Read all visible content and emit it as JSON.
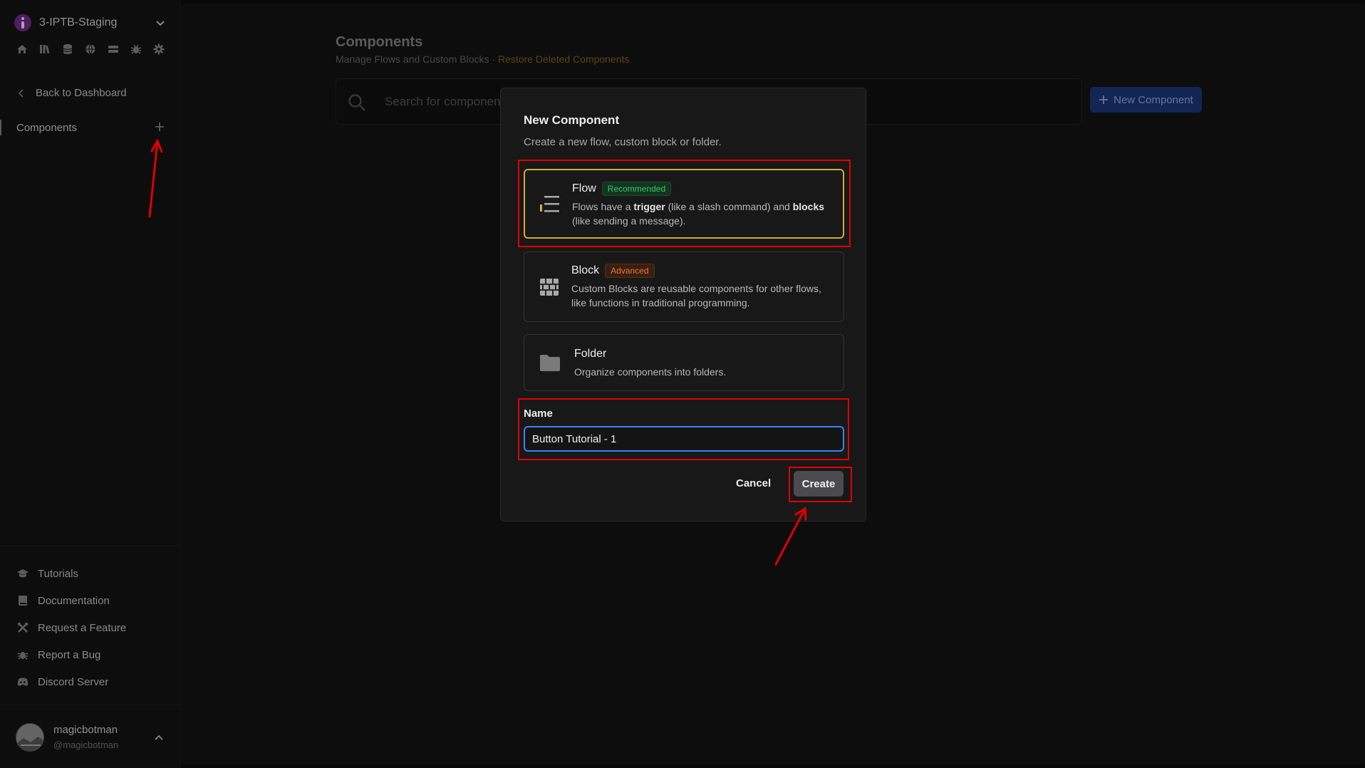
{
  "workspace": {
    "name": "3-IPTB-Staging"
  },
  "sidebar": {
    "icons": [
      "home-icon",
      "library-icon",
      "database-icon",
      "globe-icon",
      "server-icon",
      "bug-icon",
      "gear-icon"
    ],
    "back_label": "Back to Dashboard",
    "section_label": "Components",
    "bottom_links": [
      {
        "label": "Tutorials",
        "icon": "graduation-cap-icon"
      },
      {
        "label": "Documentation",
        "icon": "book-icon"
      },
      {
        "label": "Request a Feature",
        "icon": "tools-icon"
      },
      {
        "label": "Report a Bug",
        "icon": "bug-icon"
      },
      {
        "label": "Discord Server",
        "icon": "discord-icon"
      }
    ],
    "user": {
      "name": "magicbotman",
      "handle": "@magicbotman"
    }
  },
  "main": {
    "title": "Components",
    "subtitle": "Manage Flows and Custom Blocks",
    "separator": " · ",
    "restore_link": "Restore Deleted Components",
    "search_placeholder": "Search for components",
    "new_button": "New Component"
  },
  "modal": {
    "title": "New Component",
    "description": "Create a new flow, custom block or folder.",
    "options": {
      "flow": {
        "name": "Flow",
        "badge": "Recommended",
        "desc_1": "Flows have a ",
        "desc_b1": "trigger",
        "desc_2": " (like a slash command) and ",
        "desc_b2": "blocks",
        "desc_3": " (like sending a message)."
      },
      "block": {
        "name": "Block",
        "badge": "Advanced",
        "desc": "Custom Blocks are reusable components for other flows, like functions in traditional programming."
      },
      "folder": {
        "name": "Folder",
        "desc": "Organize components into folders."
      }
    },
    "name_label": "Name",
    "name_value": "Button Tutorial - 1",
    "cancel_label": "Cancel",
    "create_label": "Create"
  },
  "colors": {
    "accent_yellow": "#d2ad36",
    "primary_blue": "#1d3a82",
    "annotation_red": "#e00000",
    "focus_blue": "#3b82f6"
  }
}
